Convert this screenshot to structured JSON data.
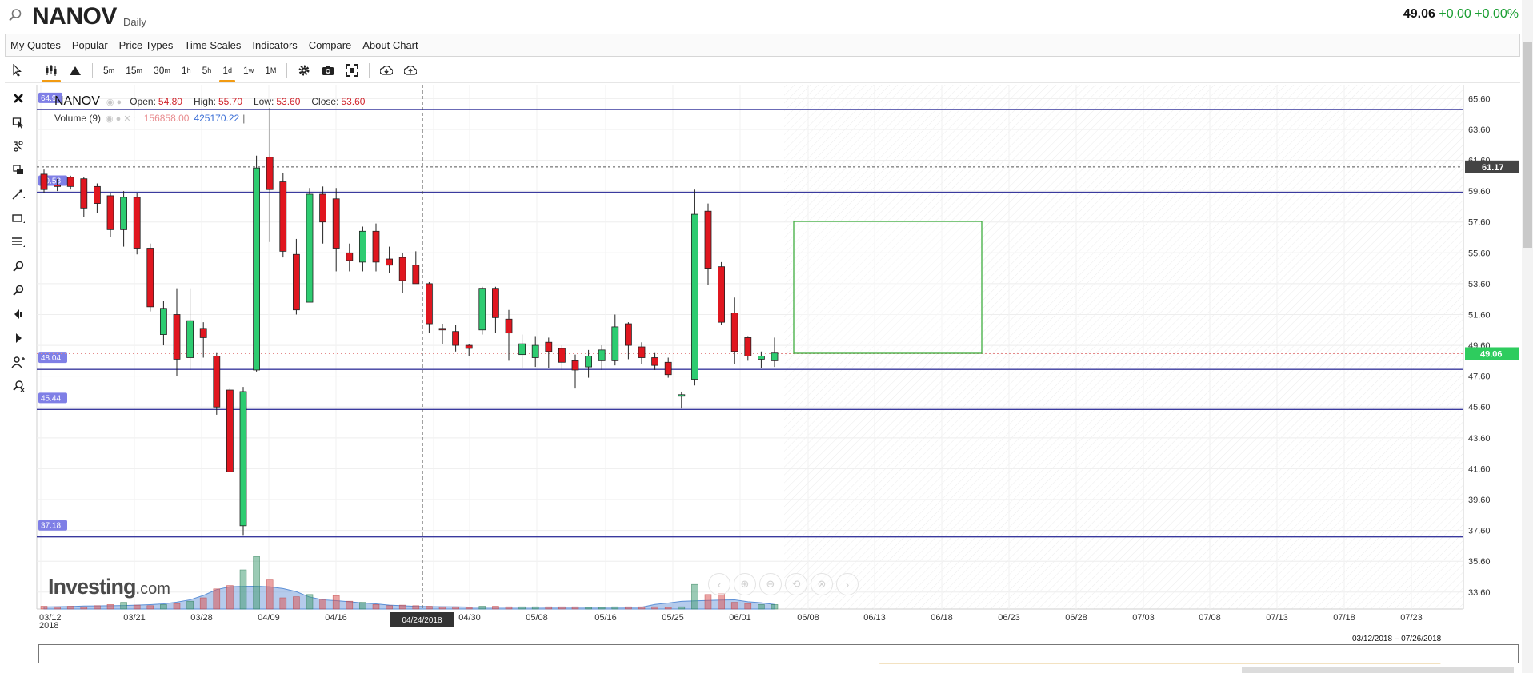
{
  "header": {
    "symbol": "NANOV",
    "interval": "Daily",
    "price": "49.06",
    "change": "+0.00",
    "change_pct": "+0.00%"
  },
  "menu": [
    "My Quotes",
    "Popular",
    "Price Types",
    "Time Scales",
    "Indicators",
    "Compare",
    "About Chart"
  ],
  "toolbar": {
    "time_scales": [
      {
        "base": "5",
        "unit": "m"
      },
      {
        "base": "15",
        "unit": "m"
      },
      {
        "base": "30",
        "unit": "m"
      },
      {
        "base": "1",
        "unit": "h"
      },
      {
        "base": "5",
        "unit": "h"
      },
      {
        "base": "1",
        "unit": "d"
      },
      {
        "base": "1",
        "unit": "w"
      },
      {
        "base": "1",
        "unit": "M"
      }
    ],
    "active_time_scale": "1d"
  },
  "legend": {
    "symbol": "NANOV",
    "open_label": "Open:",
    "open": "54.80",
    "high_label": "High:",
    "high": "55.70",
    "low_label": "Low:",
    "low": "53.60",
    "close_label": "Close:",
    "close": "53.60",
    "volume_label": "Volume (9)",
    "volume_a": "156858.00",
    "volume_b": "425170.22"
  },
  "brand": {
    "name": "Investing",
    "suffix": ".com"
  },
  "range_label": "03/12/2018 – 07/26/2018",
  "colors": {
    "up": "#2ecc71",
    "down": "#e0161f",
    "line": "#3a3a9e",
    "accent": "#f29b12",
    "price_tag": "#2ecc5e"
  },
  "icons": {
    "toolbar": [
      "cursor-icon",
      "candles-icon",
      "mountain-icon",
      "settings-icon",
      "camera-icon",
      "fullscreen-icon",
      "download-icon",
      "upload-icon"
    ],
    "draw_tools": [
      "close-icon",
      "select-icon",
      "magnet-icon",
      "layers-icon",
      "trendline-icon",
      "rectangle-icon",
      "fibonacci-icon",
      "zoom-in-icon",
      "zoom-out-icon",
      "eraser-icon",
      "arrow-icon",
      "person-add-icon",
      "measure-icon"
    ]
  },
  "chart_data": {
    "type": "candlestick",
    "y_axis": {
      "min": 32.5,
      "max": 66.5,
      "ticks": [
        "65.60",
        "63.60",
        "61.60",
        "59.60",
        "57.60",
        "55.60",
        "53.60",
        "51.60",
        "49.60",
        "47.60",
        "45.60",
        "43.60",
        "41.60",
        "39.60",
        "37.60",
        "35.60",
        "33.60"
      ],
      "tick_values": [
        65.6,
        63.6,
        61.6,
        59.6,
        57.6,
        55.6,
        53.6,
        51.6,
        49.6,
        47.6,
        45.6,
        43.6,
        41.6,
        39.6,
        37.6,
        35.6,
        33.6
      ]
    },
    "x_ticks": [
      "03/12",
      "03/21",
      "03/28",
      "04/09",
      "04/16",
      "04/24/2018",
      "04/30",
      "05/08",
      "05/16",
      "05/25",
      "06/01",
      "06/08",
      "06/13",
      "06/18",
      "06/23",
      "06/28",
      "07/03",
      "07/08",
      "07/13",
      "07/18",
      "07/23"
    ],
    "x_first_year": "2018",
    "crosshair_date": "04/24/2018",
    "candles": [
      {
        "o": 60.7,
        "h": 61.0,
        "l": 59.5,
        "c": 59.7
      },
      {
        "o": 60.0,
        "h": 60.4,
        "l": 59.6,
        "c": 59.9
      },
      {
        "o": 60.5,
        "h": 60.6,
        "l": 59.7,
        "c": 59.9
      },
      {
        "o": 60.4,
        "h": 60.5,
        "l": 57.9,
        "c": 58.5
      },
      {
        "o": 59.9,
        "h": 60.1,
        "l": 58.2,
        "c": 58.8
      },
      {
        "o": 59.3,
        "h": 59.5,
        "l": 56.6,
        "c": 57.1
      },
      {
        "o": 57.1,
        "h": 59.6,
        "l": 56.0,
        "c": 59.2
      },
      {
        "o": 59.2,
        "h": 59.5,
        "l": 55.5,
        "c": 55.9
      },
      {
        "o": 55.9,
        "h": 56.2,
        "l": 51.8,
        "c": 52.1
      },
      {
        "o": 50.3,
        "h": 52.5,
        "l": 49.6,
        "c": 52.0
      },
      {
        "o": 51.6,
        "h": 53.3,
        "l": 47.6,
        "c": 48.7
      },
      {
        "o": 48.8,
        "h": 53.3,
        "l": 48.0,
        "c": 51.2
      },
      {
        "o": 50.7,
        "h": 51.1,
        "l": 48.8,
        "c": 50.1
      },
      {
        "o": 48.9,
        "h": 49.1,
        "l": 45.1,
        "c": 45.6
      },
      {
        "o": 46.7,
        "h": 46.8,
        "l": 42.2,
        "c": 41.4
      },
      {
        "o": 37.9,
        "h": 46.9,
        "l": 37.3,
        "c": 46.6
      },
      {
        "o": 48.0,
        "h": 61.9,
        "l": 47.9,
        "c": 61.1
      },
      {
        "o": 61.8,
        "h": 65.0,
        "l": 56.3,
        "c": 59.7
      },
      {
        "o": 60.2,
        "h": 60.8,
        "l": 55.3,
        "c": 55.7
      },
      {
        "o": 55.5,
        "h": 56.5,
        "l": 51.6,
        "c": 51.9
      },
      {
        "o": 52.4,
        "h": 59.8,
        "l": 52.4,
        "c": 59.4
      },
      {
        "o": 59.4,
        "h": 59.9,
        "l": 56.2,
        "c": 57.6
      },
      {
        "o": 59.1,
        "h": 59.8,
        "l": 54.4,
        "c": 55.9
      },
      {
        "o": 55.6,
        "h": 56.2,
        "l": 54.4,
        "c": 55.1
      },
      {
        "o": 55.0,
        "h": 57.3,
        "l": 54.4,
        "c": 57.0
      },
      {
        "o": 57.0,
        "h": 57.5,
        "l": 54.4,
        "c": 55.0
      },
      {
        "o": 55.2,
        "h": 56.0,
        "l": 54.3,
        "c": 54.8
      },
      {
        "o": 55.3,
        "h": 55.6,
        "l": 53.0,
        "c": 53.8
      },
      {
        "o": 54.8,
        "h": 55.7,
        "l": 53.6,
        "c": 53.6
      },
      {
        "o": 53.6,
        "h": 53.7,
        "l": 50.4,
        "c": 51.0
      },
      {
        "o": 50.7,
        "h": 51.0,
        "l": 49.7,
        "c": 50.6
      },
      {
        "o": 50.5,
        "h": 50.9,
        "l": 49.2,
        "c": 49.6
      },
      {
        "o": 49.6,
        "h": 49.7,
        "l": 48.9,
        "c": 49.4
      },
      {
        "o": 50.6,
        "h": 53.4,
        "l": 50.3,
        "c": 53.3
      },
      {
        "o": 53.3,
        "h": 53.4,
        "l": 50.4,
        "c": 51.4
      },
      {
        "o": 51.3,
        "h": 51.9,
        "l": 48.6,
        "c": 50.4
      },
      {
        "o": 49.0,
        "h": 50.3,
        "l": 48.1,
        "c": 49.7
      },
      {
        "o": 48.8,
        "h": 50.2,
        "l": 48.2,
        "c": 49.6
      },
      {
        "o": 49.8,
        "h": 50.1,
        "l": 48.1,
        "c": 49.2
      },
      {
        "o": 49.4,
        "h": 49.6,
        "l": 48.0,
        "c": 48.5
      },
      {
        "o": 48.6,
        "h": 49.0,
        "l": 46.8,
        "c": 48.0
      },
      {
        "o": 48.2,
        "h": 49.3,
        "l": 47.5,
        "c": 48.9
      },
      {
        "o": 48.6,
        "h": 49.6,
        "l": 48.0,
        "c": 49.3
      },
      {
        "o": 48.6,
        "h": 51.6,
        "l": 48.3,
        "c": 50.8
      },
      {
        "o": 51.0,
        "h": 51.1,
        "l": 48.7,
        "c": 49.6
      },
      {
        "o": 49.5,
        "h": 49.8,
        "l": 48.4,
        "c": 48.8
      },
      {
        "o": 48.8,
        "h": 49.1,
        "l": 48.0,
        "c": 48.3
      },
      {
        "o": 48.5,
        "h": 48.8,
        "l": 47.5,
        "c": 47.7
      },
      {
        "o": 46.3,
        "h": 46.6,
        "l": 45.5,
        "c": 46.4
      },
      {
        "o": 47.4,
        "h": 59.7,
        "l": 47.0,
        "c": 58.1
      },
      {
        "o": 58.3,
        "h": 58.8,
        "l": 53.5,
        "c": 54.6
      },
      {
        "o": 54.7,
        "h": 55.0,
        "l": 50.9,
        "c": 51.1
      },
      {
        "o": 51.7,
        "h": 52.7,
        "l": 48.4,
        "c": 49.2
      },
      {
        "o": 50.1,
        "h": 50.2,
        "l": 48.6,
        "c": 48.9
      },
      {
        "o": 48.7,
        "h": 49.2,
        "l": 48.1,
        "c": 48.9
      },
      {
        "o": 48.6,
        "h": 50.1,
        "l": 48.2,
        "c": 49.1
      }
    ],
    "volumes": [
      0.05,
      0.04,
      0.05,
      0.04,
      0.06,
      0.08,
      0.12,
      0.07,
      0.06,
      0.08,
      0.1,
      0.14,
      0.2,
      0.36,
      0.42,
      0.7,
      0.94,
      0.52,
      0.2,
      0.22,
      0.26,
      0.18,
      0.24,
      0.14,
      0.12,
      0.08,
      0.06,
      0.07,
      0.06,
      0.05,
      0.04,
      0.04,
      0.03,
      0.05,
      0.05,
      0.04,
      0.04,
      0.04,
      0.04,
      0.04,
      0.04,
      0.03,
      0.03,
      0.04,
      0.04,
      0.04,
      0.04,
      0.03,
      0.04,
      0.44,
      0.26,
      0.28,
      0.12,
      0.1,
      0.08,
      0.08
    ],
    "horizontal_levels": [
      {
        "value": 64.9,
        "tag": "64.9"
      },
      {
        "value": 59.53,
        "tag": "59.53"
      },
      {
        "value": 48.04,
        "tag": "48.04"
      },
      {
        "value": 45.44,
        "tag": "45.44"
      },
      {
        "value": 37.18,
        "tag": "37.18"
      }
    ],
    "dashed_level": {
      "value": 61.17,
      "tag": "61.17"
    },
    "last_price": {
      "value": 49.06,
      "tag": "49.06"
    },
    "y_axis_partial_ticks": [
      "61.60",
      "49.60"
    ]
  }
}
